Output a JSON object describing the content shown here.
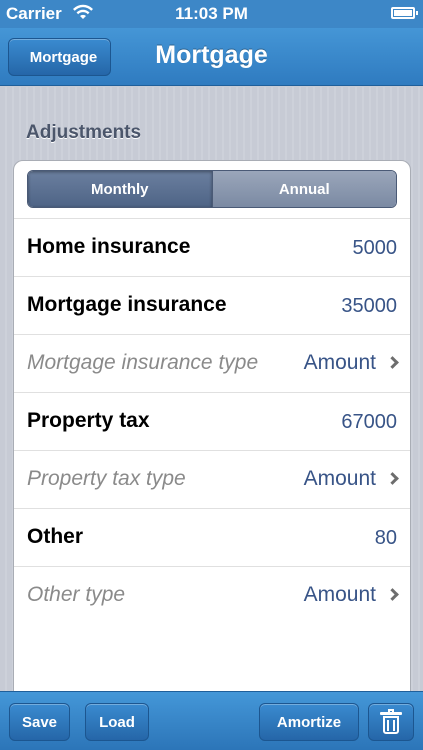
{
  "status_bar": {
    "carrier": "Carrier",
    "time": "11:03 PM"
  },
  "nav": {
    "back_label": "Mortgage",
    "title": "Mortgage"
  },
  "section": {
    "header": "Adjustments"
  },
  "segmented": {
    "options": [
      "Monthly",
      "Annual"
    ],
    "selected": "Monthly"
  },
  "rows": [
    {
      "label": "Home insurance",
      "value": "5000"
    },
    {
      "label": "Mortgage insurance",
      "value": "35000"
    },
    {
      "label": "Mortgage insurance type",
      "value": "Amount"
    },
    {
      "label": "Property tax",
      "value": "67000"
    },
    {
      "label": "Property tax type",
      "value": "Amount"
    },
    {
      "label": "Other",
      "value": "80"
    },
    {
      "label": "Other type",
      "value": "Amount"
    }
  ],
  "toolbar": {
    "save": "Save",
    "load": "Load",
    "amortize": "Amortize"
  },
  "colors": {
    "accent": "#3d87c7",
    "value_text": "#385487"
  },
  "icons": [
    "wifi-icon",
    "battery-icon",
    "chevron-right-icon",
    "trash-icon"
  ]
}
